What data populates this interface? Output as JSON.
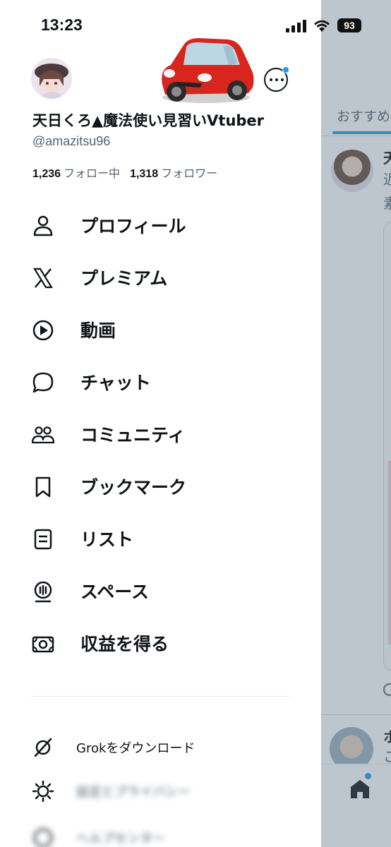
{
  "status_bar": {
    "time": "13:23",
    "battery": "93"
  },
  "profile": {
    "display_name": "天日くろ▲魔法使い見習いVtuber",
    "handle": "@amazitsu96",
    "following_count": "1,236",
    "following_label": "フォロー中",
    "followers_count": "1,318",
    "followers_label": "フォロワー"
  },
  "menu": [
    {
      "label": "プロフィール",
      "icon": "person-icon"
    },
    {
      "label": "プレミアム",
      "icon": "x-logo-icon"
    },
    {
      "label": "動画",
      "icon": "play-icon"
    },
    {
      "label": "チャット",
      "icon": "chat-bubble-icon"
    },
    {
      "label": "コミュニティ",
      "icon": "community-icon"
    },
    {
      "label": "ブックマーク",
      "icon": "bookmark-icon"
    },
    {
      "label": "リスト",
      "icon": "list-icon"
    },
    {
      "label": "スペース",
      "icon": "spaces-mic-icon"
    },
    {
      "label": "収益を得る",
      "icon": "money-icon"
    }
  ],
  "secondary": [
    {
      "label": "Grokをダウンロード",
      "icon": "grok-icon"
    },
    {
      "label": "設定とプライバシー",
      "icon": "gear-icon"
    },
    {
      "label": "ヘルプセンター",
      "icon": "help-icon"
    }
  ],
  "timeline": {
    "tab_label": "おすすめ",
    "post_name_char": "天",
    "post_line2_char": "近",
    "post_line3_char": "素",
    "post2_name_char": "ホ",
    "post2_line2_char": "こ"
  },
  "colors": {
    "accent": "#1d9bf0",
    "text": "#0f1419",
    "muted": "#536471"
  }
}
